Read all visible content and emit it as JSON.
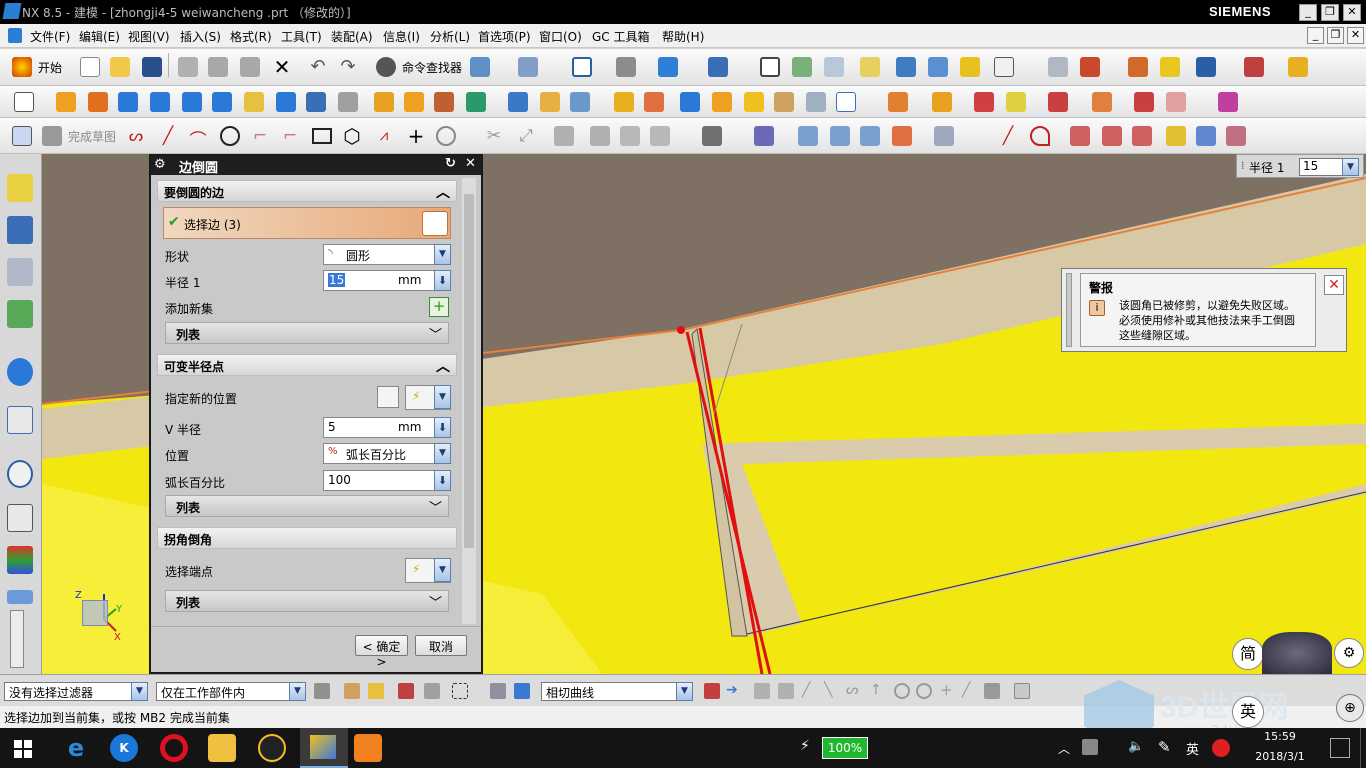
{
  "titlebar": {
    "title": "NX 8.5 - 建模 - [zhongji4-5    weiwancheng    .prt （修改的）]",
    "brand": "SIEMENS",
    "min": "_",
    "max": "❐",
    "close": "✕"
  },
  "menubar": {
    "items": [
      "文件(F)",
      "编辑(E)",
      "视图(V)",
      "插入(S)",
      "格式(R)",
      "工具(T)",
      "装配(A)",
      "信息(I)",
      "分析(L)",
      "首选项(P)",
      "窗口(O)",
      "GC 工具箱",
      "帮助(H)"
    ]
  },
  "toolbar": {
    "start_label": "开始",
    "command_finder_label": "命令查找器",
    "finish_sketch_label": "完成草图"
  },
  "dialog": {
    "title": "边倒圆",
    "sections": {
      "edge": "要倒圆的边",
      "variable": "可变半径点",
      "corner": "拐角倒角"
    },
    "select_edge": "选择边 (3)",
    "shape_label": "形状",
    "shape_value": "圆形",
    "radius_label": "半径 1",
    "radius_value": "15",
    "radius_unit": "mm",
    "add_set_label": "添加新集",
    "list_label": "列表",
    "specify_location_label": "指定新的位置",
    "v_radius_label": "V 半径",
    "v_radius_value": "5",
    "v_radius_unit": "mm",
    "position_label": "位置",
    "position_value": "弧长百分比",
    "arc_percent_label": "弧长百分比",
    "arc_percent_value": "100",
    "select_endpoint_label": "选择端点",
    "ok_label": "< 确定 >",
    "cancel_label": "取消"
  },
  "radius_overlay": {
    "label": "半径 1",
    "value": "15"
  },
  "warning": {
    "title": "警报",
    "message_lines": [
      "该圆角已被修剪，以避免失败区域。",
      "必须使用修补或其他技法来手工倒圆",
      "这些缝隙区域。"
    ],
    "close": "✕"
  },
  "statusbar": {
    "filter": "没有选择过滤器",
    "scope": "仅在工作部件内",
    "curve_rule": "相切曲线"
  },
  "cue": "选择边加到当前集，或按 MB2 完成当前集",
  "taskbar": {
    "battery": "100%",
    "ime": "英",
    "time": "15:59",
    "date": "2018/3/1"
  },
  "watermark": {
    "site": "3D世界网",
    "url": "www.3dsjw.com"
  },
  "float_buttons": {
    "jian": "简",
    "ying": "英"
  },
  "axes": {
    "x": "X",
    "y": "Y",
    "z": "Z"
  },
  "colors": {
    "yellow": "#f2e80f",
    "edge_red": "#e01010",
    "wall_brown": "#7e7063",
    "beige": "#d7c8a6",
    "dialog_bg": "#c9c9c9"
  }
}
